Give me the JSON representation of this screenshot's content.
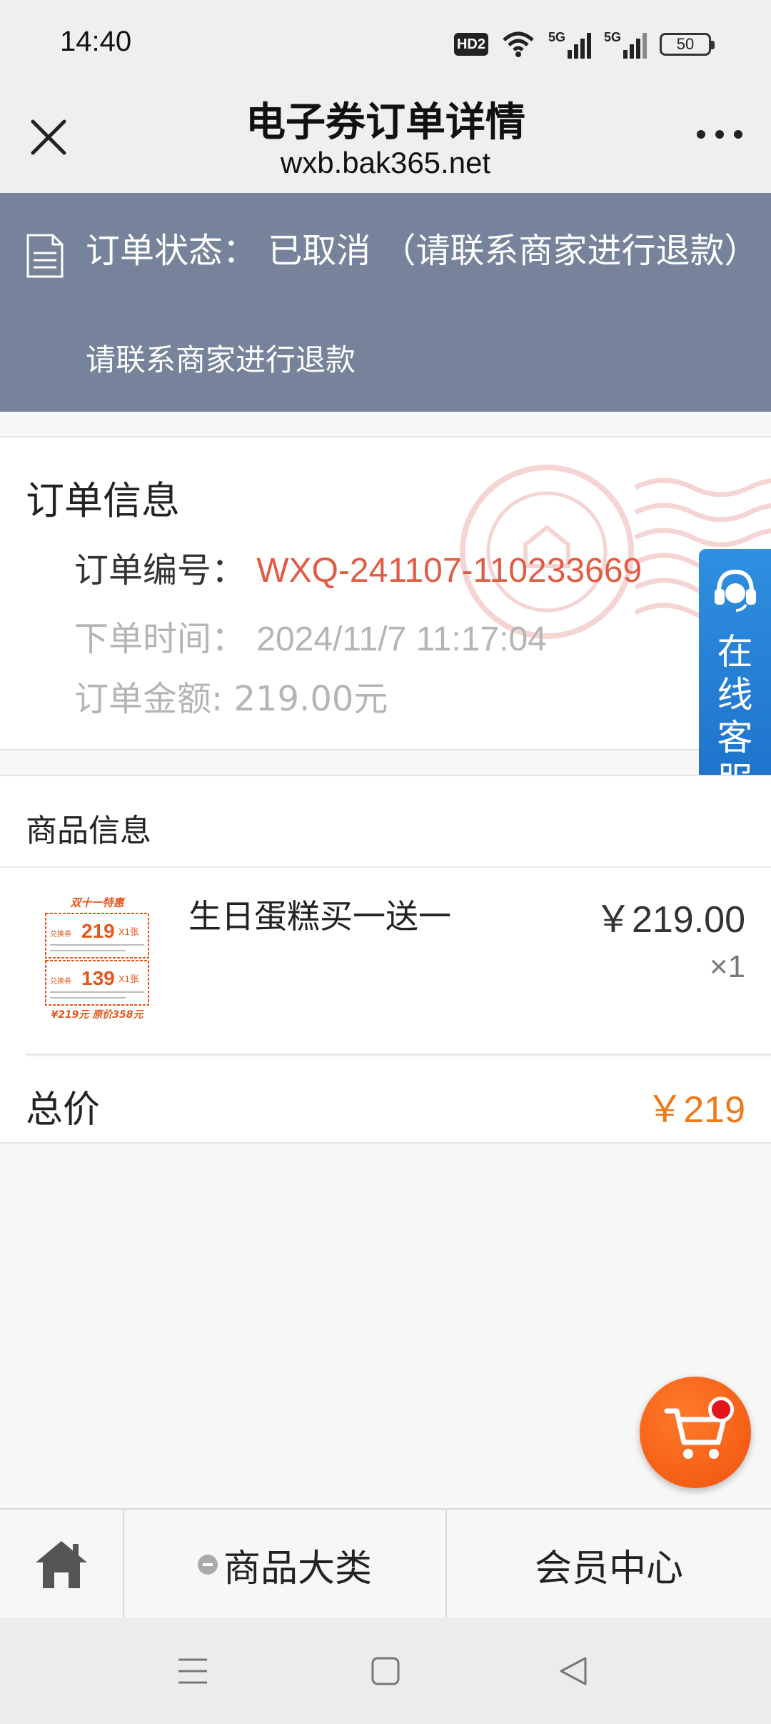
{
  "status_bar": {
    "time": "14:40",
    "hd_label": "HD2",
    "network_1": "5G",
    "network_2": "5G",
    "battery": "50"
  },
  "header": {
    "title": "电子券订单详情",
    "url": "wxb.bak365.net"
  },
  "order_status": {
    "main_text": "订单状态：  已取消 （请联系商家进行退款）",
    "sub_text": "请联系商家进行退款"
  },
  "order_info": {
    "section_title": "订单信息",
    "order_no_label": "订单编号：",
    "order_no_value": "WXQ-241107-110233669",
    "order_time_label": "下单时间：",
    "order_time_value": "2024/11/7 11:17:04",
    "order_amount_label": "订单金额:",
    "order_amount_value": "219.00元"
  },
  "customer_service": {
    "label": "在线客服"
  },
  "goods": {
    "section_title": "商品信息",
    "items": [
      {
        "name": "生日蛋糕买一送一",
        "price": "￥219.00",
        "quantity": "×1",
        "thumb": {
          "headline": "双十一特惠",
          "coupon1_price": "219",
          "coupon1_text": "兑换券",
          "coupon1_count": "X1张",
          "coupon2_price": "139",
          "coupon2_text": "兑换券",
          "coupon2_count": "X1张",
          "footer": "¥219元 原价358元"
        }
      }
    ],
    "total_label": "总价",
    "total_value": "￥219"
  },
  "bottom_nav": {
    "category_label": "商品大类",
    "member_label": "会员中心"
  },
  "colors": {
    "status_banner": "#76839b",
    "order_no": "#e25b45",
    "total_price": "#f07a19",
    "cs_tab": "#1b6fc9",
    "cart_button": "#f0530e"
  }
}
